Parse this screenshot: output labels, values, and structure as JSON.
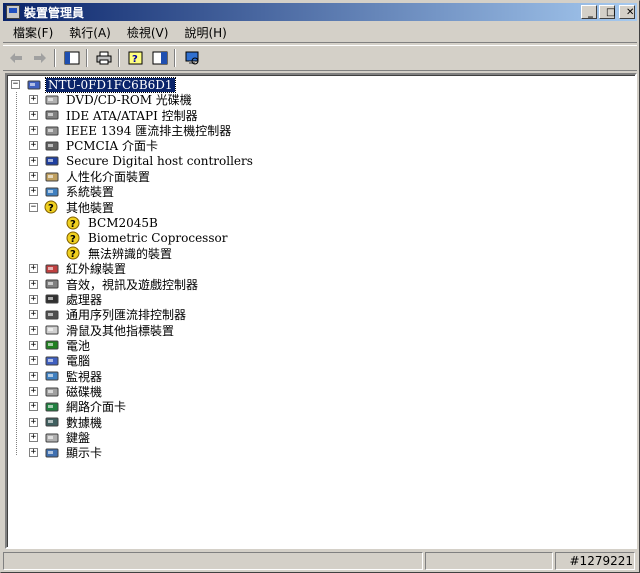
{
  "window": {
    "title": "裝置管理員"
  },
  "titlebar": {
    "minimize": "_",
    "maximize": "□",
    "close": "✕"
  },
  "menu": [
    "檔案(F)",
    "執行(A)",
    "檢視(V)",
    "說明(H)"
  ],
  "toolbar": [
    "back-icon",
    "forward-icon",
    "properties-pane-icon",
    "print-icon",
    "help-icon",
    "console-icon",
    "scan-hardware-icon"
  ],
  "tree": {
    "root": "NTU-0FD1FC6B6D1",
    "items": [
      {
        "label": "DVD/CD-ROM 光碟機",
        "icon": "dvd-icon"
      },
      {
        "label": "IDE ATA/ATAPI 控制器",
        "icon": "ide-icon"
      },
      {
        "label": "IEEE 1394 匯流排主機控制器",
        "icon": "ieee1394-icon"
      },
      {
        "label": "PCMCIA 介面卡",
        "icon": "pcmcia-icon"
      },
      {
        "label": "Secure Digital host controllers",
        "icon": "sd-icon"
      },
      {
        "label": "人性化介面裝置",
        "icon": "hid-icon"
      },
      {
        "label": "系統裝置",
        "icon": "system-icon"
      },
      {
        "label": "其他裝置",
        "icon": "unknown-device-icon",
        "expanded": true,
        "children": [
          "BCM2045B",
          "Biometric Coprocessor",
          "無法辨識的裝置"
        ]
      },
      {
        "label": "紅外線裝置",
        "icon": "infrared-icon"
      },
      {
        "label": "音效，視訊及遊戲控制器",
        "icon": "audio-icon"
      },
      {
        "label": "處理器",
        "icon": "cpu-icon"
      },
      {
        "label": "通用序列匯流排控制器",
        "icon": "usb-icon"
      },
      {
        "label": "滑鼠及其他指標裝置",
        "icon": "mouse-icon"
      },
      {
        "label": "電池",
        "icon": "battery-icon"
      },
      {
        "label": "電腦",
        "icon": "computer-icon"
      },
      {
        "label": "監視器",
        "icon": "monitor-icon"
      },
      {
        "label": "磁碟機",
        "icon": "disk-icon"
      },
      {
        "label": "網路介面卡",
        "icon": "network-icon"
      },
      {
        "label": "數據機",
        "icon": "modem-icon"
      },
      {
        "label": "鍵盤",
        "icon": "keyboard-icon"
      },
      {
        "label": "顯示卡",
        "icon": "display-adapter-icon"
      }
    ]
  },
  "status": {
    "watermark": "#1279221"
  }
}
